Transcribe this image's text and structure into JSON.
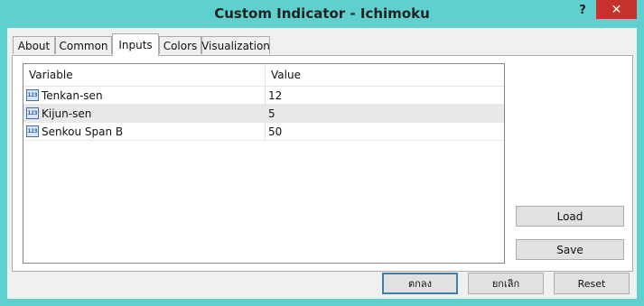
{
  "window": {
    "title": "Custom Indicator - Ichimoku",
    "help_glyph": "?",
    "close_glyph": "✕"
  },
  "tabs": [
    {
      "label": "About"
    },
    {
      "label": "Common"
    },
    {
      "label": "Inputs",
      "active": true
    },
    {
      "label": "Colors"
    },
    {
      "label": "Visualization"
    }
  ],
  "grid": {
    "columns": [
      "Variable",
      "Value"
    ],
    "icon_text": "123",
    "rows": [
      {
        "variable": "Tenkan-sen",
        "value": "12"
      },
      {
        "variable": "Kijun-sen",
        "value": "5"
      },
      {
        "variable": "Senkou Span B",
        "value": "50"
      }
    ]
  },
  "side_buttons": {
    "load": "Load",
    "save": "Save"
  },
  "bottom_buttons": {
    "ok": "ตกลง",
    "cancel": "ยกเลิก",
    "reset": "Reset"
  }
}
